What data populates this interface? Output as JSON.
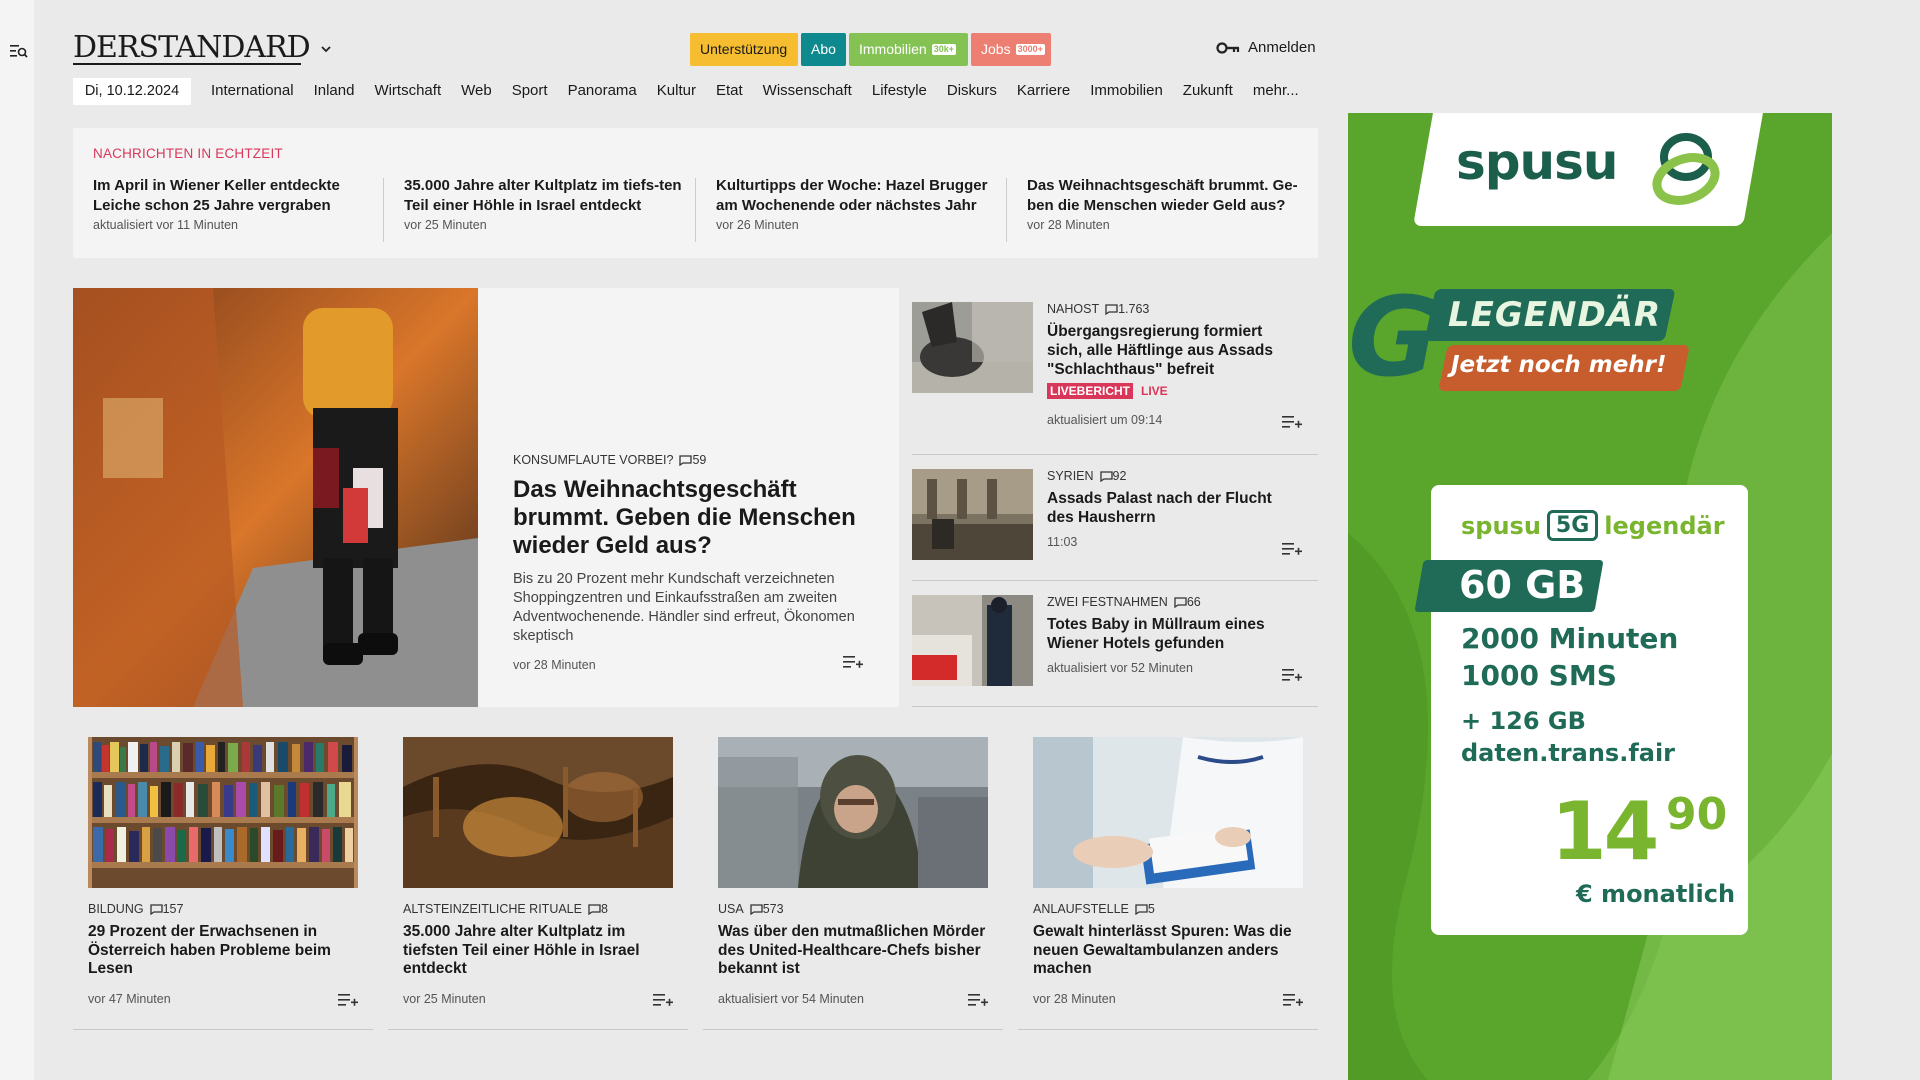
{
  "header": {
    "logo": "DERSTANDARD",
    "pills": {
      "support": "Unterstützung",
      "abo": "Abo",
      "immo": "Immobilien",
      "immo_badge": "30k+",
      "jobs": "Jobs",
      "jobs_badge": "3000+"
    },
    "login": "Anmelden"
  },
  "nav": {
    "date": "Di, 10.12.2024",
    "items": [
      "International",
      "Inland",
      "Wirtschaft",
      "Web",
      "Sport",
      "Panorama",
      "Kultur",
      "Etat",
      "Wissenschaft",
      "Lifestyle",
      "Diskurs",
      "Karriere",
      "Immobilien",
      "Zukunft",
      "mehr..."
    ]
  },
  "realtime": {
    "heading": "NACHRICHTEN IN ECHTZEIT",
    "items": [
      {
        "title": "Im April in Wiener Keller entdeckte Leiche schon 25 Jahre vergraben",
        "meta": "aktualisiert vor 11 Minuten"
      },
      {
        "title": "35.000 Jahre alter Kultplatz im tiefs-ten Teil einer Höhle in Israel entdeckt",
        "meta": "vor 25 Minuten"
      },
      {
        "title": "Kulturtipps der Woche: Hazel Brugger am Wochenende oder nächstes Jahr",
        "meta": "vor 26 Minuten"
      },
      {
        "title": "Das Weihnachtsgeschäft brummt. Ge-ben die Menschen wieder Geld aus?",
        "meta": "vor 28 Minuten"
      }
    ]
  },
  "hero": {
    "kicker": "KONSUMFLAUTE VORBEI?",
    "comments": "59",
    "title": "Das Weihnachtsgeschäft brummt. Geben die Menschen wieder Geld aus?",
    "lead": "Bis zu 20 Prozent mehr Kundschaft verzeichneten Shoppingzentren und Einkaufsstraßen am zweiten Adventwochenende. Händler sind erfreut, Ökonomen skeptisch",
    "time": "vor 28 Minuten"
  },
  "side": [
    {
      "kicker": "NAHOST",
      "comments": "1.763",
      "title": "Übergangsregierung formiert sich, alle Häftlinge aus Assads \"Schlachthaus\" befreit",
      "live_badge": "LIVEBERICHT",
      "live": "LIVE",
      "time": "aktualisiert um 09:14"
    },
    {
      "kicker": "SYRIEN",
      "comments": "92",
      "title": "Assads Palast nach der Flucht des Hausherrn",
      "time": "11:03"
    },
    {
      "kicker": "ZWEI FESTNAHMEN",
      "comments": "66",
      "title": "Totes Baby in Müllraum eines Wiener Hotels gefunden",
      "time": "aktualisiert vor 52 Minuten"
    }
  ],
  "cards": [
    {
      "kicker": "BILDUNG",
      "comments": "157",
      "title": "29 Prozent der Erwachsenen in Österreich haben Probleme beim Lesen",
      "time": "vor 47 Minuten"
    },
    {
      "kicker": "ALTSTEINZEITLICHE RITUALE",
      "comments": "8",
      "title": "35.000 Jahre alter Kultplatz im tiefsten Teil einer Höhle in Israel entdeckt",
      "time": "vor 25 Minuten"
    },
    {
      "kicker": "USA",
      "comments": "573",
      "title": "Was über den mutmaßlichen Mörder des United-Healthcare-Chefs bisher bekannt ist",
      "time": "aktualisiert vor 54 Minuten"
    },
    {
      "kicker": "ANLAUFSTELLE",
      "comments": "5",
      "title": "Gewalt hinterlässt Spuren: Was die neuen Gewaltambulanzen anders machen",
      "time": "vor 28 Minuten"
    }
  ],
  "ad": {
    "brand": "spusu",
    "g": "G",
    "legendaer": "LEGENDÄR",
    "jetzt": "Jetzt noch mehr!",
    "card_brand": "spusu",
    "card_5g": "5G",
    "card_legendaer": "legendär",
    "gb": "60 GB",
    "minutes": "2000 Minuten",
    "sms": "1000 SMS",
    "extra_gb": "+ 126 GB",
    "url": "daten.trans.fair",
    "price_main": "14",
    "price_cents": "90",
    "monthly": "€ monatlich"
  },
  "colors": {
    "accent_red": "#d9375a",
    "support": "#f5bd2f",
    "abo": "#0e8a8f",
    "immo": "#85c254",
    "jobs": "#ec7f72",
    "ad_green": "#5aa62c",
    "ad_dark": "#1f6b57"
  },
  "icons": [
    "menu-search-icon",
    "chevron-down-icon",
    "key-icon",
    "comment-icon",
    "add-to-list-icon"
  ]
}
